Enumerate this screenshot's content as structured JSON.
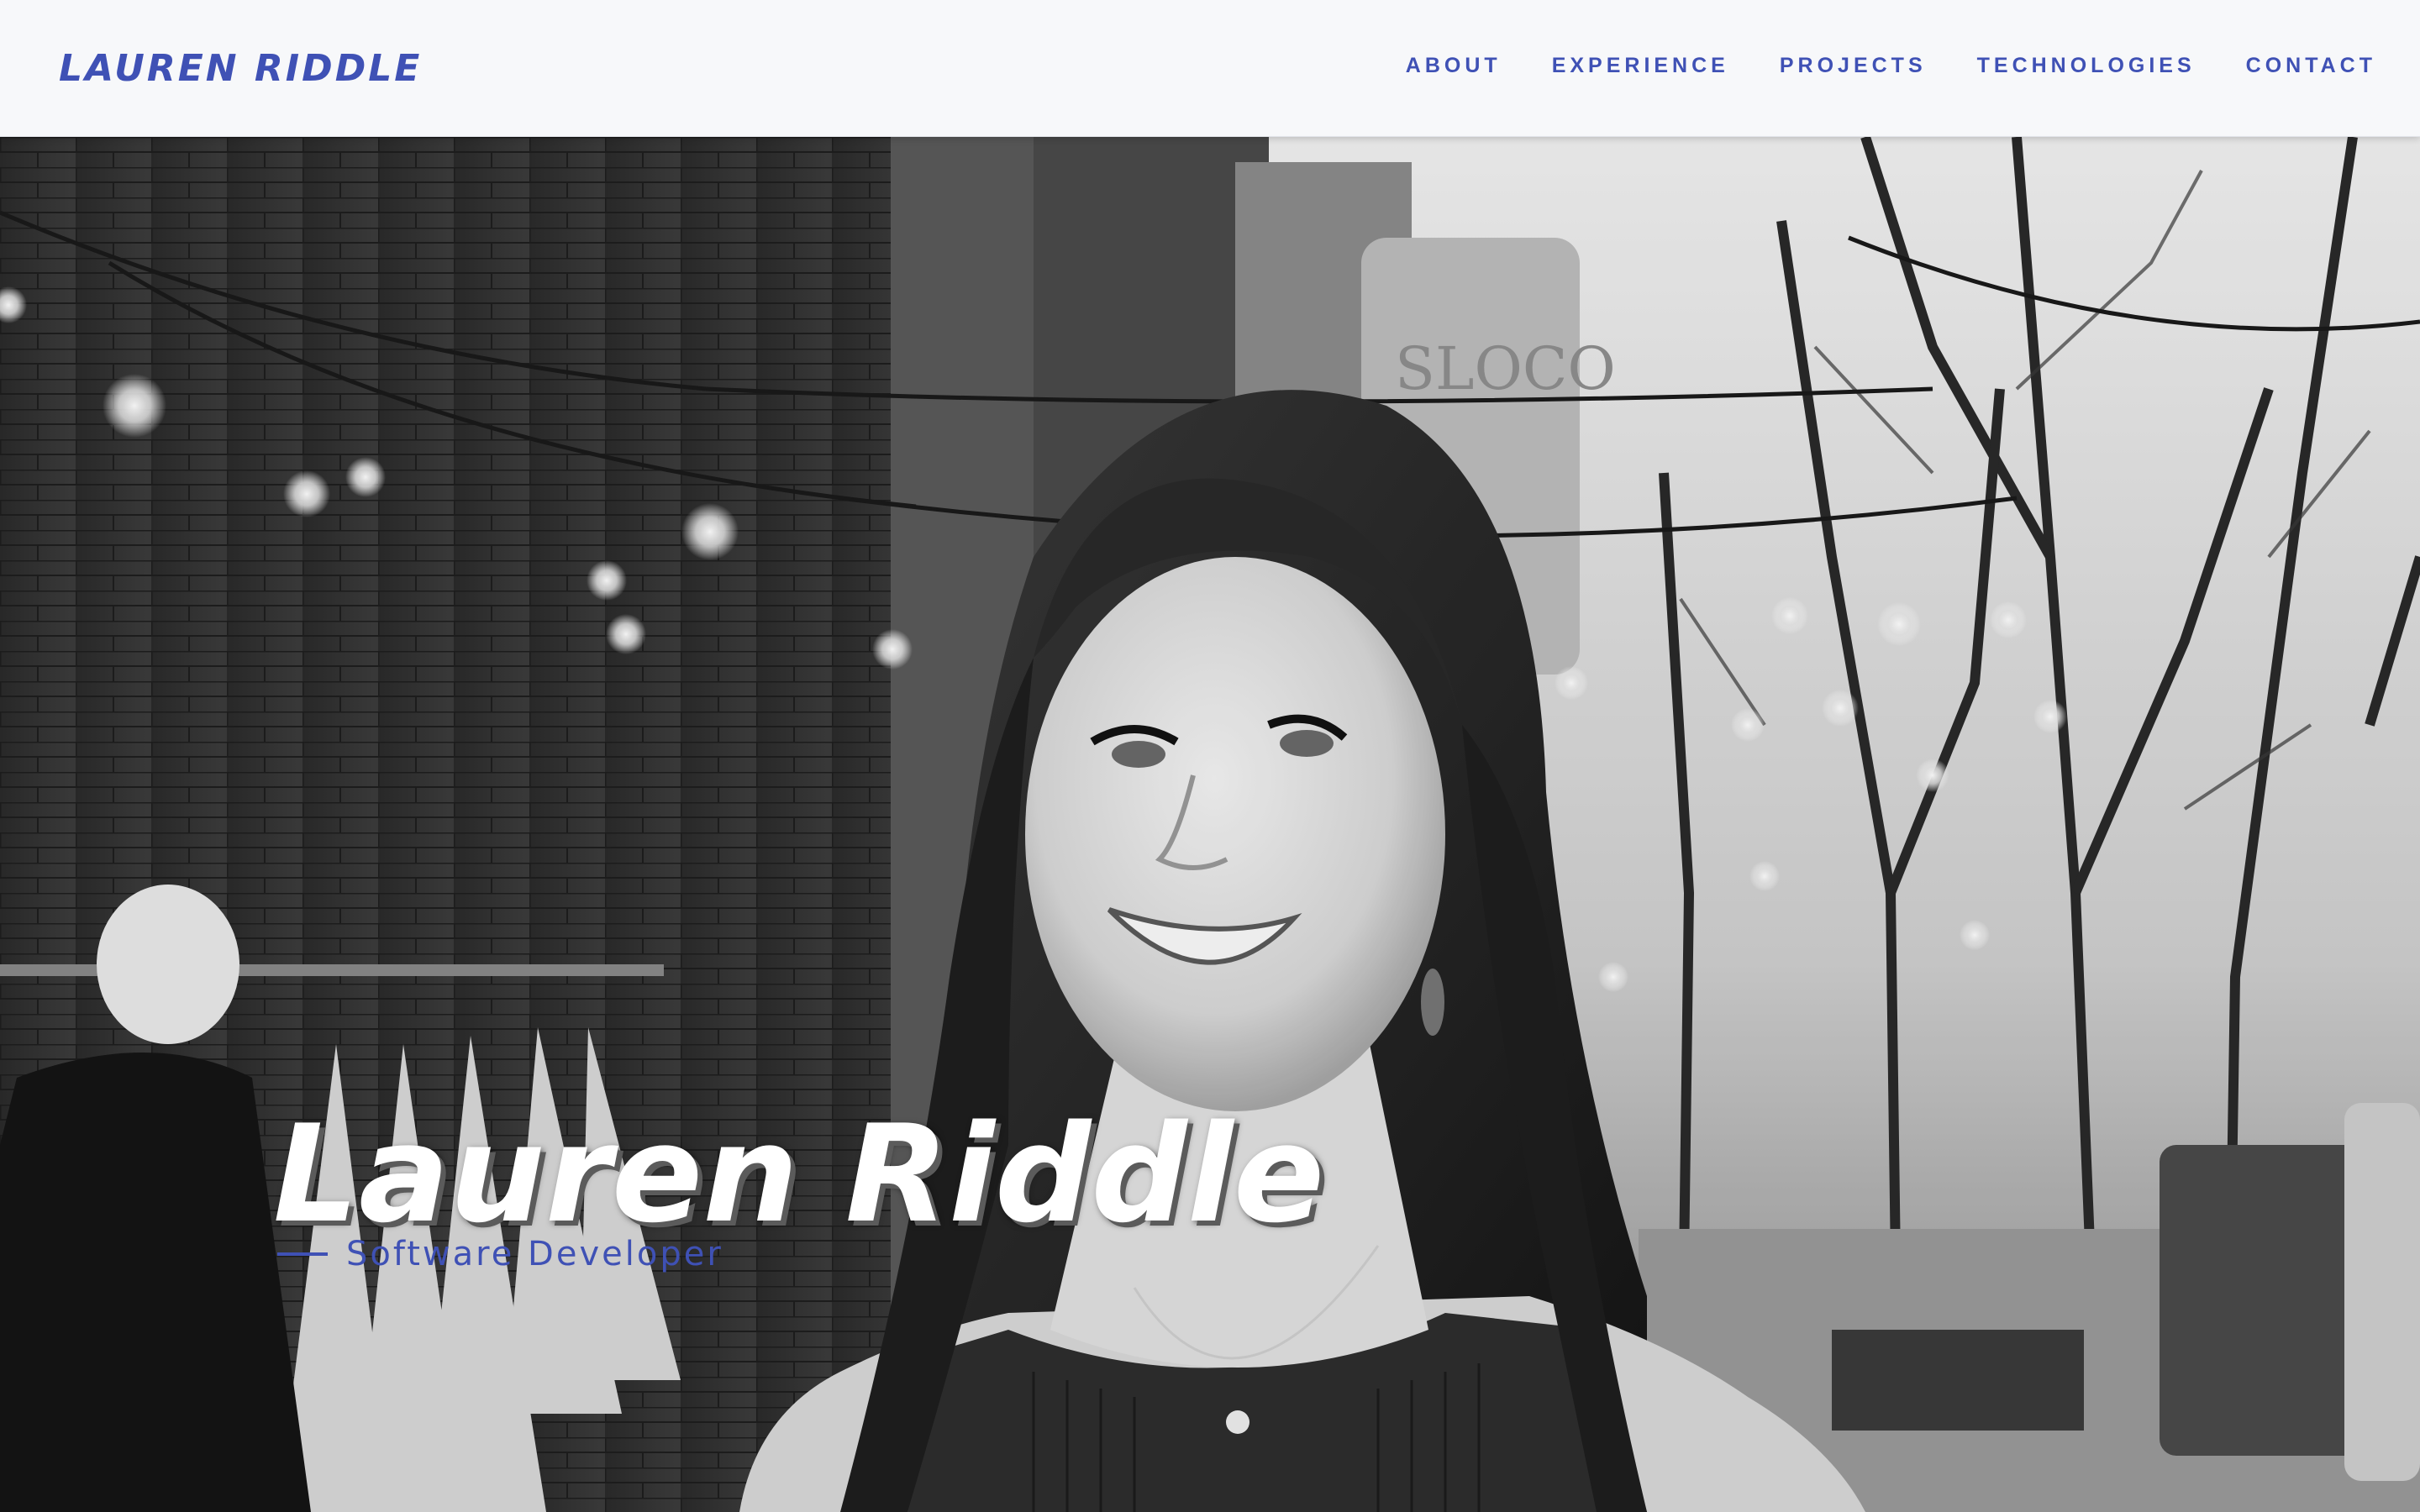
{
  "header": {
    "brand": "Lauren Riddle",
    "nav_items": [
      {
        "label": "ABOUT"
      },
      {
        "label": "EXPERIENCE"
      },
      {
        "label": "PROJECTS"
      },
      {
        "label": "TECHNOLOGIES"
      },
      {
        "label": "CONTACT"
      }
    ]
  },
  "hero": {
    "name": "Lauren Riddle",
    "subtitle": "Software Developer",
    "photo_icon": "portrait-photo"
  },
  "colors": {
    "accent": "#3f51b5",
    "navbar_bg": "#f7f8fa",
    "hero_title": "#ffffff"
  }
}
